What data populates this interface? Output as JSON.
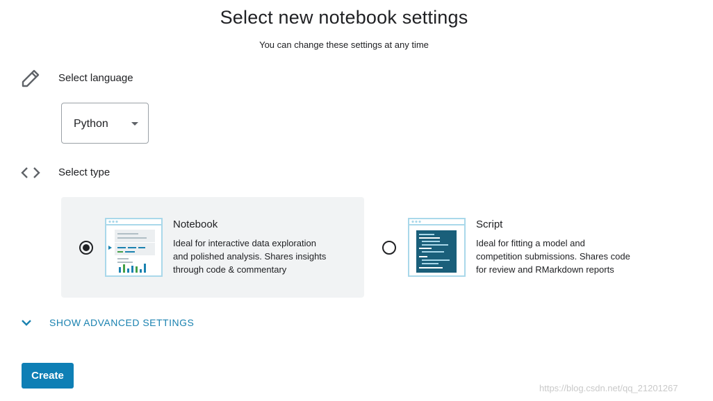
{
  "header": {
    "title": "Select new notebook settings",
    "subtitle": "You can change these settings at any time"
  },
  "language": {
    "icon": "pencil-icon",
    "label": "Select language",
    "selected": "Python"
  },
  "type": {
    "icon": "code-brackets-icon",
    "label": "Select type",
    "options": [
      {
        "title": "Notebook",
        "desc_lines": [
          "Ideal for interactive data exploration",
          "and polished analysis. Shares insights",
          "through code & commentary"
        ],
        "selected": true,
        "icon": "notebook-illustration-icon"
      },
      {
        "title": "Script",
        "desc_lines": [
          "Ideal for fitting a model and",
          "competition submissions. Shares code",
          "for review and RMarkdown reports"
        ],
        "selected": false,
        "icon": "script-illustration-icon"
      }
    ]
  },
  "advanced": {
    "label": "SHOW ADVANCED SETTINGS",
    "icon": "chevron-down-icon"
  },
  "actions": {
    "create_label": "Create"
  },
  "watermark": "https://blog.csdn.net/qq_21201267",
  "colors": {
    "accent": "#0e7fb5",
    "link": "#1a82b0",
    "selected_card_bg": "#f1f3f4"
  }
}
